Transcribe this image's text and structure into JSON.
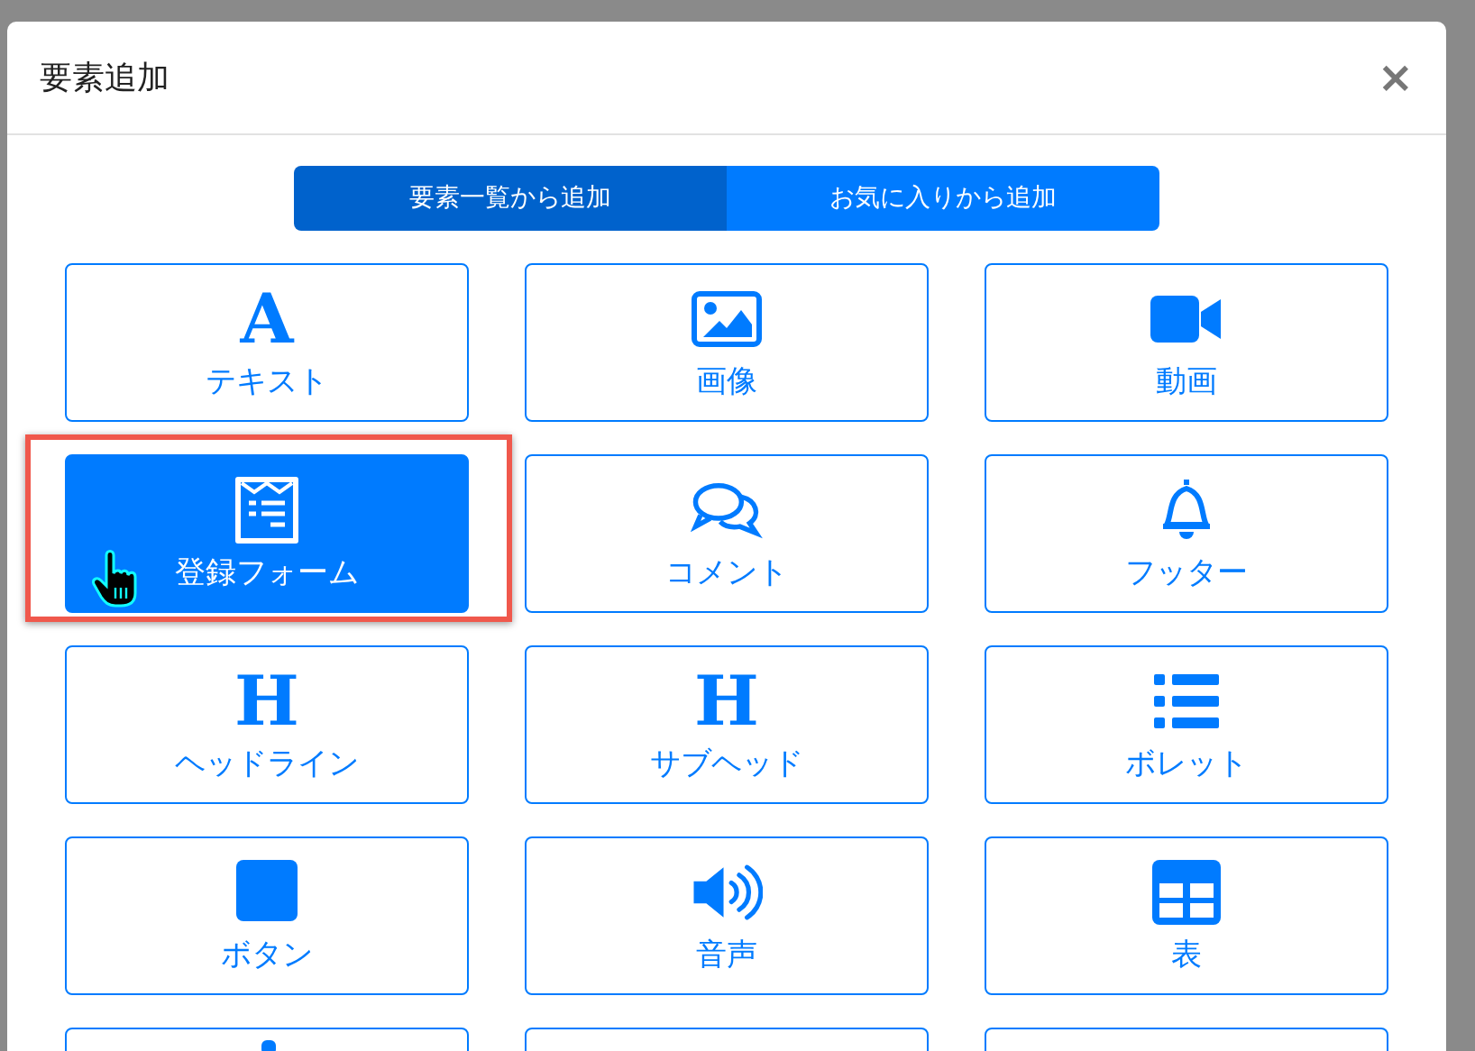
{
  "dialog": {
    "title": "要素追加",
    "close": "×"
  },
  "tabs": [
    {
      "label": "要素一覧から追加",
      "selected": true
    },
    {
      "label": "お気に入りから追加",
      "selected": false
    }
  ],
  "elements": [
    {
      "kind": "glyph",
      "glyph": "A",
      "label": "テキスト",
      "selected": false
    },
    {
      "kind": "image",
      "label": "画像",
      "selected": false
    },
    {
      "kind": "video",
      "label": "動画",
      "selected": false
    },
    {
      "kind": "form",
      "label": "登録フォーム",
      "selected": true
    },
    {
      "kind": "comments",
      "label": "コメント",
      "selected": false
    },
    {
      "kind": "bell",
      "label": "フッター",
      "selected": false
    },
    {
      "kind": "glyph",
      "glyph": "H",
      "label": "ヘッドライン",
      "selected": false
    },
    {
      "kind": "glyph",
      "glyph": "H",
      "label": "サブヘッド",
      "selected": false
    },
    {
      "kind": "list",
      "label": "ボレット",
      "selected": false
    },
    {
      "kind": "square",
      "label": "ボタン",
      "selected": false
    },
    {
      "kind": "volume",
      "label": "音声",
      "selected": false
    },
    {
      "kind": "table",
      "label": "表",
      "selected": false
    },
    {
      "kind": "partial",
      "selected": false
    },
    {
      "kind": "blank",
      "selected": false
    },
    {
      "kind": "blank",
      "selected": false
    }
  ]
}
